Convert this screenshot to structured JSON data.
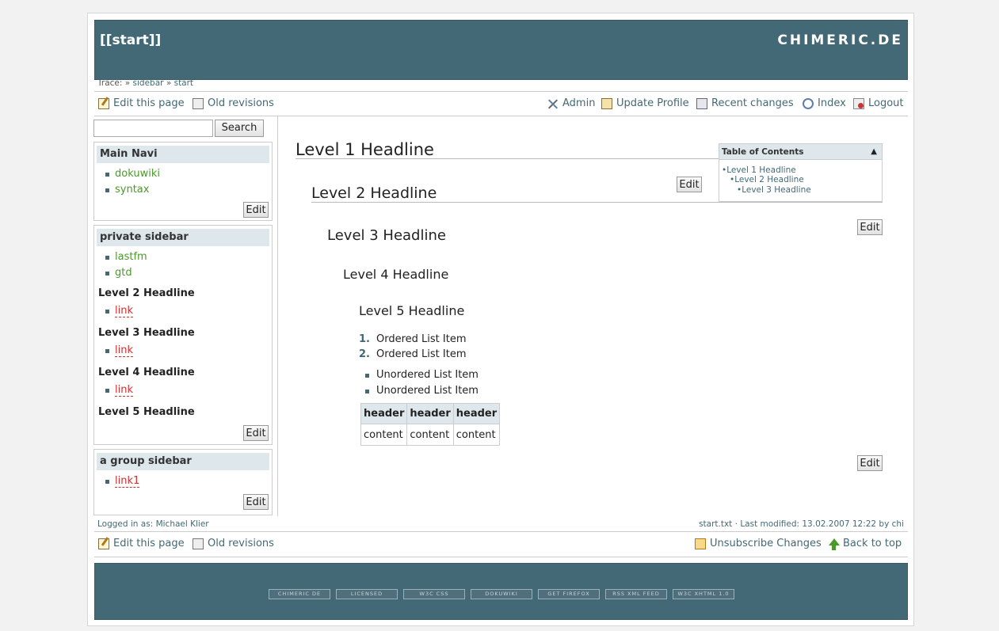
{
  "header": {
    "title": "[[start]]",
    "logo": "CHIMERIC.DE"
  },
  "trace": {
    "label": "Trace:",
    "sep": "»",
    "items": [
      "sidebar",
      "start"
    ]
  },
  "topbar": {
    "edit": "Edit this page",
    "revisions": "Old revisions",
    "admin": "Admin",
    "profile": "Update Profile",
    "recent": "Recent changes",
    "index": "Index",
    "logout": "Logout"
  },
  "search": {
    "button": "Search",
    "value": ""
  },
  "sidebar": {
    "edit_label": "Edit",
    "main_navi": {
      "title": "Main Navi",
      "items": [
        "dokuwiki",
        "syntax"
      ]
    },
    "private": {
      "title": "private sidebar",
      "items": [
        "lastfm",
        "gtd"
      ],
      "h2": "Level 2 Headline",
      "h2_link": "link",
      "h3": "Level 3 Headline",
      "h3_link": "link",
      "h4": "Level 4 Headline",
      "h4_link": "link",
      "h5": "Level 5 Headline"
    },
    "group": {
      "title": "a group sidebar",
      "items": [
        "link1"
      ]
    }
  },
  "content": {
    "h1": "Level 1 Headline",
    "h2": "Level 2 Headline",
    "h3": "Level 3 Headline",
    "h4": "Level 4 Headline",
    "h5": "Level 5 Headline",
    "edit_label": "Edit",
    "ordered": [
      "Ordered List Item",
      "Ordered List Item"
    ],
    "unordered": [
      "Unordered List Item",
      "Unordered List Item"
    ],
    "table": {
      "headers": [
        "header",
        "header",
        "header"
      ],
      "row": [
        "content",
        "content",
        "content"
      ]
    }
  },
  "toc": {
    "title": "Table of Contents",
    "toggle": "▲",
    "items": [
      "Level 1 Headline",
      "Level 2 Headline",
      "Level 3 Headline"
    ]
  },
  "footer": {
    "logged_in": "Logged in as: Michael Klier",
    "modified": "start.txt · Last modified: 13.02.2007 12:22 by chi",
    "unsubscribe": "Unsubscribe Changes",
    "back_to_top": "Back to top",
    "badges": [
      "CHIMERIC DE",
      "LICENSED",
      "W3C CSS",
      "DOKUWIKI",
      "GET FIREFOX",
      "RSS XML FEED",
      "W3C XHTML 1.0"
    ]
  }
}
